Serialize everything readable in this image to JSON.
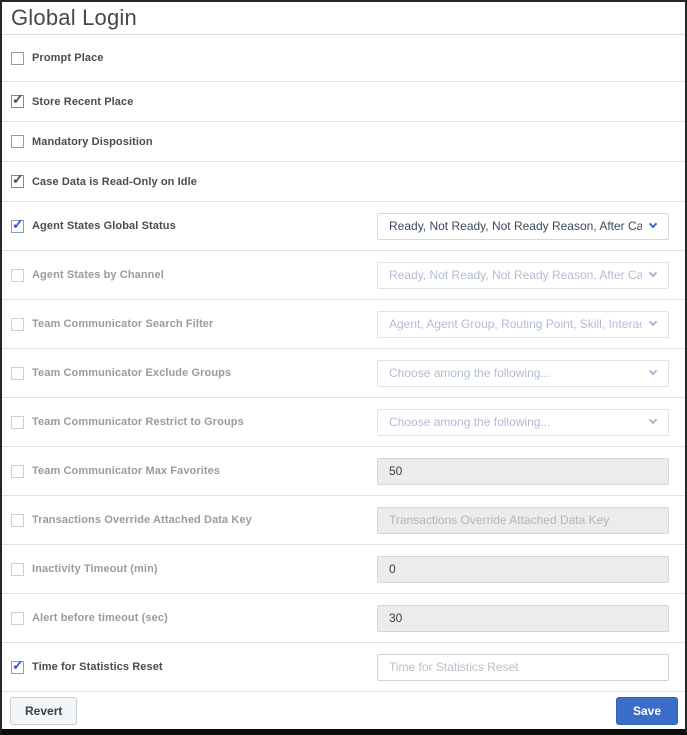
{
  "page": {
    "title": "Global Login"
  },
  "colors": {
    "save_button_blue": "#3b6dc9",
    "check_blue": "#3353d4",
    "check_dark": "#4a4a4a",
    "divider": "#e0e0e0",
    "disabled_label_gray": "#9b9b9b",
    "active_label_dark": "#4c4c4c",
    "disabled_select_text": "#b1bcd1",
    "disabled_input_bg": "#ececec"
  },
  "icons": {
    "chevron": "chevron-down-icon",
    "checkmark": "checkmark-icon"
  },
  "rows": [
    {
      "label": "Prompt Place",
      "checked": false
    },
    {
      "label": "Store Recent Place",
      "checked": true,
      "check_style": "dark"
    },
    {
      "label": "Mandatory Disposition",
      "checked": false
    },
    {
      "label": "Case Data is Read-Only on Idle",
      "checked": true,
      "check_style": "dark"
    },
    {
      "label": "Agent States Global Status",
      "checked": true,
      "check_style": "blue",
      "control": {
        "type": "select",
        "enabled": true,
        "value": "Ready, Not Ready, Not Ready Reason, After Call Work, D..."
      }
    },
    {
      "label": "Agent States by Channel",
      "checked": false,
      "control": {
        "type": "select",
        "enabled": false,
        "value": "Ready, Not Ready, Not Ready Reason, After Call Work, D..."
      }
    },
    {
      "label": "Team Communicator Search Filter",
      "checked": false,
      "control": {
        "type": "select",
        "enabled": false,
        "value": "Agent, Agent Group, Routing Point, Skill, Interaction Que..."
      }
    },
    {
      "label": "Team Communicator Exclude Groups",
      "checked": false,
      "control": {
        "type": "select",
        "enabled": false,
        "value": "Choose among the following..."
      }
    },
    {
      "label": "Team Communicator Restrict to Groups",
      "checked": false,
      "control": {
        "type": "select",
        "enabled": false,
        "value": "Choose among the following..."
      }
    },
    {
      "label": "Team Communicator Max Favorites",
      "checked": false,
      "control": {
        "type": "input",
        "enabled": false,
        "value": "50",
        "placeholder": ""
      }
    },
    {
      "label": "Transactions Override Attached Data Key",
      "checked": false,
      "control": {
        "type": "input",
        "enabled": false,
        "value": "",
        "placeholder": "Transactions Override Attached Data Key"
      }
    },
    {
      "label": "Inactivity Timeout (min)",
      "checked": false,
      "control": {
        "type": "input",
        "enabled": false,
        "value": "0",
        "placeholder": ""
      }
    },
    {
      "label": "Alert before timeout (sec)",
      "checked": false,
      "control": {
        "type": "input",
        "enabled": false,
        "value": "30",
        "placeholder": ""
      }
    },
    {
      "label": "Time for Statistics Reset",
      "checked": true,
      "check_style": "blue",
      "control": {
        "type": "input",
        "enabled": true,
        "value": "",
        "placeholder": "Time for Statistics Reset"
      }
    }
  ],
  "footer": {
    "revert_label": "Revert",
    "save_label": "Save"
  }
}
